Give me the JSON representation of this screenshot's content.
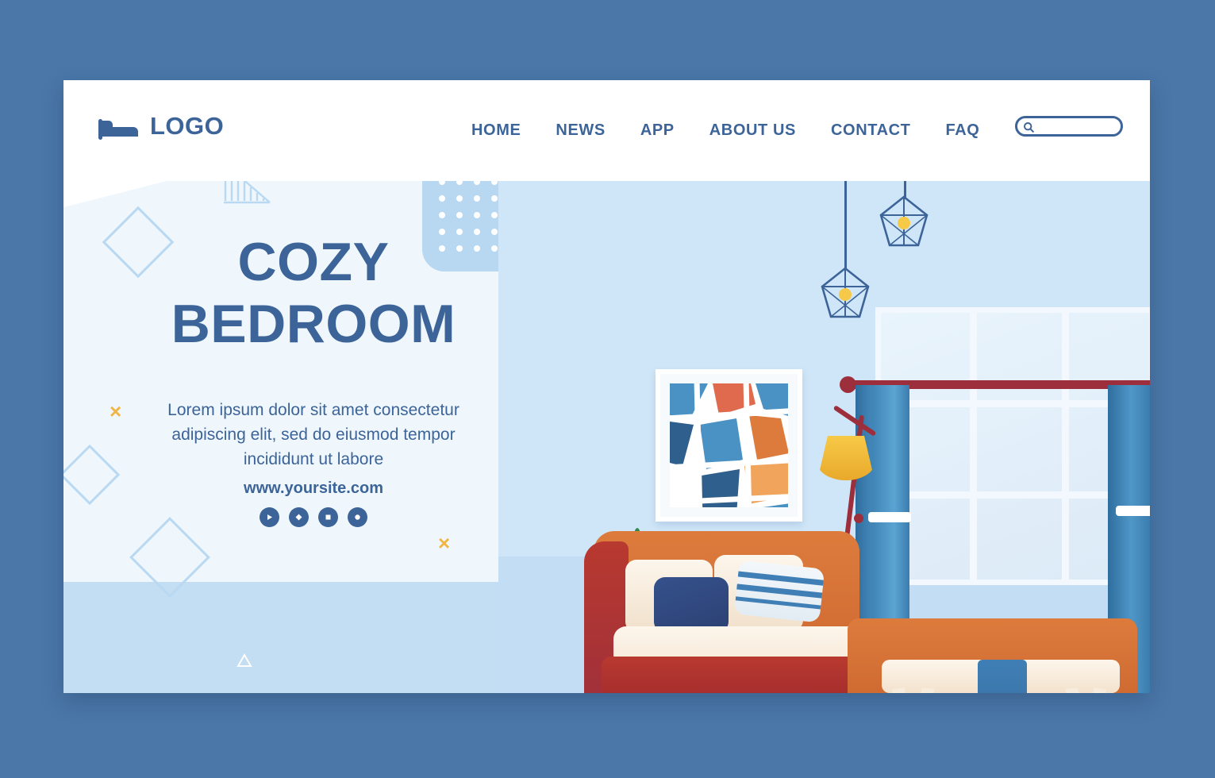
{
  "page": {
    "background_color": "#4a77a8",
    "card_background": "#ffffff",
    "accent_color": "#3c6498",
    "accent_light": "#c3ddf2",
    "accent_yellow": "#f0b545"
  },
  "navbar": {
    "logo": {
      "icon": "bed-icon",
      "text": "LOGO"
    },
    "links": [
      {
        "label": "HOME"
      },
      {
        "label": "NEWS"
      },
      {
        "label": "APP"
      },
      {
        "label": "ABOUT US"
      },
      {
        "label": "CONTACT"
      },
      {
        "label": "FAQ"
      }
    ],
    "search": {
      "icon": "search-icon",
      "placeholder": "",
      "value": ""
    }
  },
  "hero": {
    "title_line1": "COZY",
    "title_line2": "BEDROOM",
    "subtitle": "Lorem ipsum dolor sit amet consectetur adipiscing elit, sed do eiusmod tempor incididunt ut labore",
    "url": "www.yoursite.com",
    "socials": [
      {
        "name": "play-icon",
        "glyph": "▶"
      },
      {
        "name": "diamond-icon",
        "glyph": "◆"
      },
      {
        "name": "square-icon",
        "glyph": "■"
      },
      {
        "name": "circle-icon",
        "glyph": "●"
      }
    ]
  },
  "decorations": {
    "x_marks": [
      {
        "label": "×"
      },
      {
        "label": "×"
      },
      {
        "label": "×"
      }
    ],
    "triangles": [
      {
        "label": "triangle-outline"
      },
      {
        "label": "triangle-outline"
      },
      {
        "label": "triangle-outline"
      }
    ],
    "diamonds": [
      {
        "label": "diamond-outline"
      },
      {
        "label": "diamond-outline"
      },
      {
        "label": "diamond-outline"
      }
    ],
    "dots_panel": {
      "rows": 5,
      "cols": 5,
      "color": "#b8d7f1"
    },
    "hatch_triangle": {
      "color": "#b9d8f1"
    }
  },
  "illustration": {
    "name": "cozy-bedroom-illustration",
    "elements": [
      {
        "name": "framed-abstract-art"
      },
      {
        "name": "pendant-lamp-left"
      },
      {
        "name": "pendant-lamp-right"
      },
      {
        "name": "wall-swing-arm-lamp"
      },
      {
        "name": "window-with-curtains"
      },
      {
        "name": "orange-sofa"
      },
      {
        "name": "striped-pillow"
      },
      {
        "name": "navy-pillow"
      },
      {
        "name": "side-table-with-plant"
      },
      {
        "name": "bench-with-blue-throw"
      }
    ],
    "colors": {
      "wall": "#cfe6f8",
      "floor": "#c3ddf5",
      "sofa": "#dd7b3d",
      "sofa_dark": "#b8392f",
      "curtain": "#3f83b6",
      "rod": "#9d2f3c",
      "lampshade": "#f7c948"
    }
  }
}
